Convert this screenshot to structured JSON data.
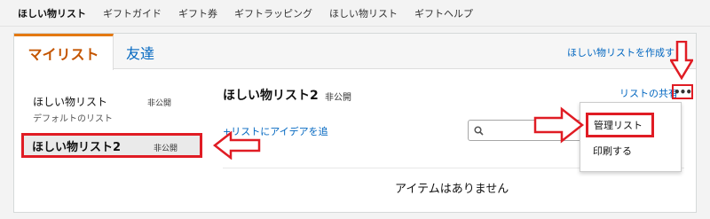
{
  "topnav": {
    "items": [
      "ほしい物リスト",
      "ギフトガイド",
      "ギフト券",
      "ギフトラッピング",
      "ほしい物リスト",
      "ギフトヘルプ"
    ]
  },
  "tabs": {
    "mylist": "マイリスト",
    "friends": "友達"
  },
  "header": {
    "create_link": "ほしい物リストを作成す"
  },
  "sidebar": {
    "items": [
      {
        "name": "ほしい物リスト",
        "privacy": "非公開",
        "subtitle": "デフォルトのリスト"
      },
      {
        "name": "ほしい物リスト2",
        "privacy": "非公開"
      }
    ]
  },
  "main": {
    "list_title": "ほしい物リスト2",
    "privacy": "非公開",
    "share_link": "リストの共有",
    "more_icon": "ellipsis-icon",
    "add_idea_link": "+リストにアイデアを追",
    "search_icon": "search-icon",
    "empty_message": "アイテムはありません"
  },
  "dropdown": {
    "manage": "管理リスト",
    "print": "印刷する"
  },
  "annotations": {
    "color": "#e01c24"
  }
}
